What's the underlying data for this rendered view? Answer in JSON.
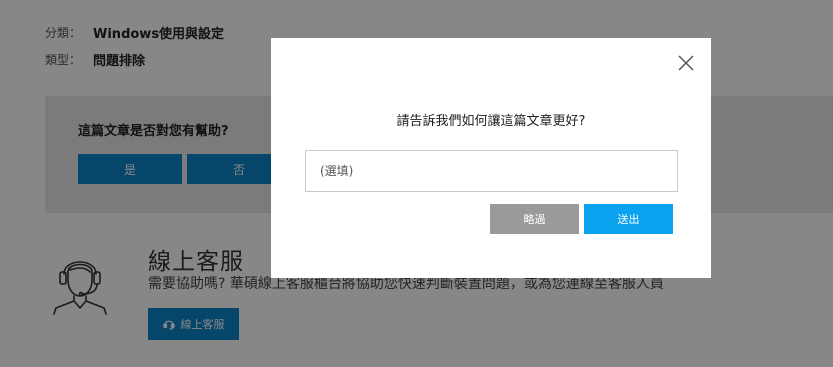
{
  "article_meta": {
    "category_label": "分類：",
    "category_value": "Windows使用與設定",
    "type_label": "類型：",
    "type_value": "問題排除"
  },
  "feedback": {
    "question": "這篇文章是否對您有幫助?",
    "yes_label": "是",
    "no_label": "否"
  },
  "online_service": {
    "title": "線上客服",
    "description": "需要協助嗎? 華碩線上客服櫃台將協助您快速判斷裝置問題，或為您連線至客服人員",
    "button_label": "線上客服",
    "icon": "headset-agent-icon"
  },
  "modal": {
    "title": "請告訴我們如何讓這篇文章更好?",
    "input_placeholder": "(選填)",
    "input_value": "",
    "skip_label": "略過",
    "send_label": "送出",
    "close_icon": "close-icon"
  },
  "colors": {
    "primary_blue": "#0a84c8",
    "send_blue": "#0ba3ef",
    "skip_gray": "#9a9a9a",
    "overlay": "rgba(0,0,0,0.47)"
  }
}
